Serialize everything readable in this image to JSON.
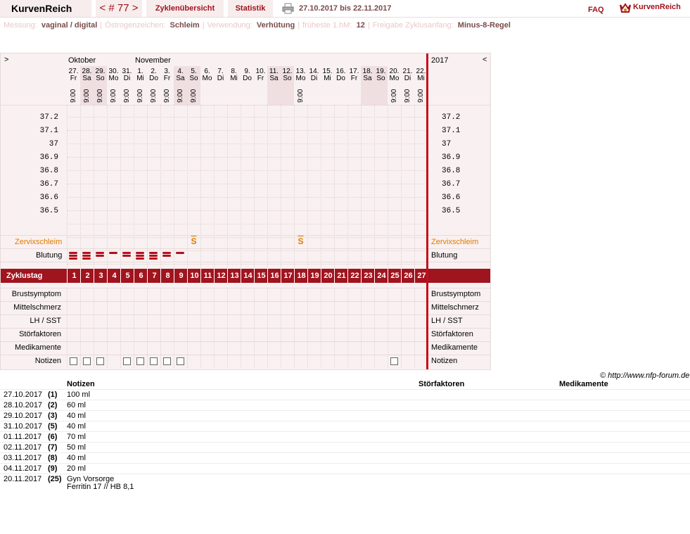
{
  "header": {
    "brand": "KurvenReich",
    "cycle_label": "< # 77 >",
    "overview_label": "Zyklenübersicht",
    "stats_label": "Statistik",
    "date_range": "27.10.2017 bis 22.11.2017",
    "faq_label": "FAQ",
    "logo_text": "KurvenReich"
  },
  "settings": [
    {
      "label": "Messung:",
      "value": "vaginal / digital"
    },
    {
      "label": "Östrogenzeichen:",
      "value": "Schleim"
    },
    {
      "label": "Verwendung:",
      "value": "Verhütung"
    },
    {
      "label": "früheste 1.hM:",
      "value": "12"
    },
    {
      "label": "Freigabe Zyklusanfang:",
      "value": "Minus-8-Regel"
    }
  ],
  "chart": {
    "nav_left": ">",
    "nav_right": "<",
    "month1": "Oktober",
    "month2": "November",
    "year": "2017",
    "days": [
      {
        "d": "27.",
        "w": "Fr",
        "t": "9:00",
        "we": false
      },
      {
        "d": "28.",
        "w": "Sa",
        "t": "9:00",
        "we": true
      },
      {
        "d": "29.",
        "w": "So",
        "t": "9:00",
        "we": true
      },
      {
        "d": "30.",
        "w": "Mo",
        "t": "9:00",
        "we": false
      },
      {
        "d": "31.",
        "w": "Di",
        "t": "9:00",
        "we": false
      },
      {
        "d": "1.",
        "w": "Mi",
        "t": "9:00",
        "we": false
      },
      {
        "d": "2.",
        "w": "Do",
        "t": "9:00",
        "we": false
      },
      {
        "d": "3.",
        "w": "Fr",
        "t": "9:00",
        "we": false
      },
      {
        "d": "4.",
        "w": "Sa",
        "t": "9:00",
        "we": true
      },
      {
        "d": "5.",
        "w": "So",
        "t": "9:00",
        "we": true
      },
      {
        "d": "6.",
        "w": "Mo",
        "t": "",
        "we": false
      },
      {
        "d": "7.",
        "w": "Di",
        "t": "",
        "we": false
      },
      {
        "d": "8.",
        "w": "Mi",
        "t": "",
        "we": false
      },
      {
        "d": "9.",
        "w": "Do",
        "t": "",
        "we": false
      },
      {
        "d": "10.",
        "w": "Fr",
        "t": "",
        "we": false
      },
      {
        "d": "11.",
        "w": "Sa",
        "t": "",
        "we": true
      },
      {
        "d": "12.",
        "w": "So",
        "t": "",
        "we": true
      },
      {
        "d": "13.",
        "w": "Mo",
        "t": "9:00",
        "we": false
      },
      {
        "d": "14.",
        "w": "Di",
        "t": "",
        "we": false
      },
      {
        "d": "15.",
        "w": "Mi",
        "t": "",
        "we": false
      },
      {
        "d": "16.",
        "w": "Do",
        "t": "",
        "we": false
      },
      {
        "d": "17.",
        "w": "Fr",
        "t": "",
        "we": false
      },
      {
        "d": "18.",
        "w": "Sa",
        "t": "",
        "we": true
      },
      {
        "d": "19.",
        "w": "So",
        "t": "",
        "we": true
      },
      {
        "d": "20.",
        "w": "Mo",
        "t": "9:00",
        "we": false
      },
      {
        "d": "21.",
        "w": "Di",
        "t": "9:00",
        "we": false
      },
      {
        "d": "22.",
        "w": "Mi",
        "t": "9:00",
        "we": false
      }
    ],
    "temps": [
      "37.2",
      "37.1",
      "37",
      "36.9",
      "36.8",
      "36.7",
      "36.6",
      "36.5"
    ],
    "cervix_label": "Zervixschleim",
    "cervix_marks": [
      {
        "day": 10,
        "sym": "S"
      },
      {
        "day": 18,
        "sym": "S"
      }
    ],
    "bleeding_label": "Blutung",
    "bleeding": [
      3,
      3,
      2,
      1,
      2,
      3,
      3,
      2,
      1
    ],
    "cycle_label": "Zyklustag",
    "cycle_days": [
      "1",
      "2",
      "3",
      "4",
      "5",
      "6",
      "7",
      "8",
      "9",
      "10",
      "11",
      "12",
      "13",
      "14",
      "15",
      "16",
      "17",
      "18",
      "19",
      "20",
      "21",
      "22",
      "23",
      "24",
      "25",
      "26",
      "27"
    ],
    "rows": [
      "Brustsymptom",
      "Mittelschmerz",
      "LH / SST",
      "Störfaktoren",
      "Medikamente",
      "Notizen"
    ],
    "note_days": [
      1,
      2,
      3,
      5,
      6,
      7,
      8,
      9,
      25
    ],
    "credit": "© http://www.nfp-forum.de"
  },
  "notes_table": {
    "col_notes": "Notizen",
    "col_stoer": "Störfaktoren",
    "col_medi": "Medikamente",
    "rows": [
      {
        "date": "27.10.2017",
        "day": "(1)",
        "note": "100 ml"
      },
      {
        "date": "28.10.2017",
        "day": "(2)",
        "note": "60 ml"
      },
      {
        "date": "29.10.2017",
        "day": "(3)",
        "note": "40 ml"
      },
      {
        "date": "31.10.2017",
        "day": "(5)",
        "note": "40 ml"
      },
      {
        "date": "01.11.2017",
        "day": "(6)",
        "note": "70 ml"
      },
      {
        "date": "02.11.2017",
        "day": "(7)",
        "note": "50 ml"
      },
      {
        "date": "03.11.2017",
        "day": "(8)",
        "note": "40 ml"
      },
      {
        "date": "04.11.2017",
        "day": "(9)",
        "note": "20 ml"
      },
      {
        "date": "20.11.2017",
        "day": "(25)",
        "note": "Gyn Vorsorge",
        "note2": "Ferritin 17 // HB 8,1"
      }
    ]
  },
  "colors": {
    "accent": "#a0141e",
    "orange": "#e07a00",
    "bg": "#f9f1f1",
    "weekend": "#efdfe0"
  }
}
